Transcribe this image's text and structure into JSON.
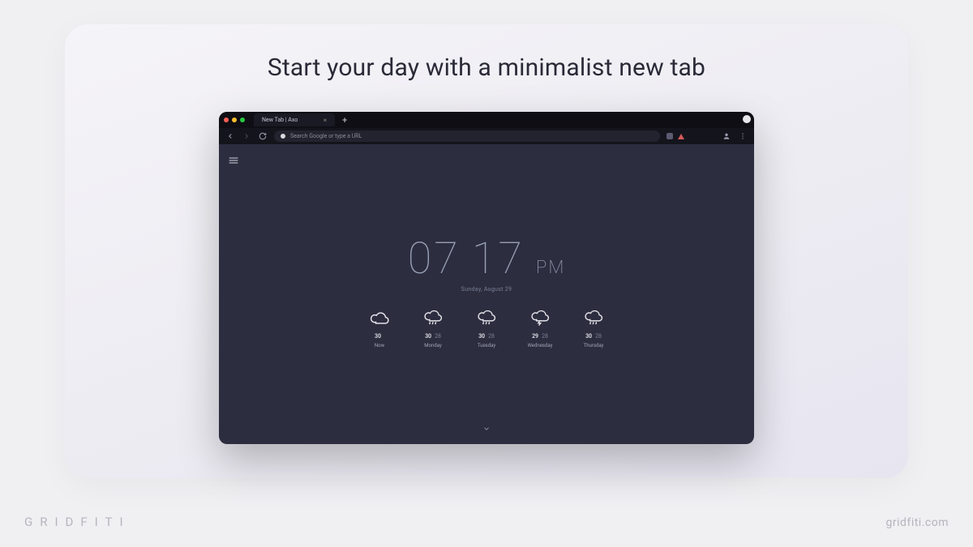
{
  "headline": "Start your day with a minimalist new tab",
  "browser": {
    "tab_title": "New Tab | Axo",
    "search_placeholder": "Search Google or type a URL"
  },
  "clock": {
    "hours": "07",
    "minutes": "17",
    "ampm": "PM",
    "date": "Sunday, August 29"
  },
  "forecast": [
    {
      "icon": "cloud",
      "hi": "30",
      "lo": "",
      "label": "Now"
    },
    {
      "icon": "rain",
      "hi": "30",
      "lo": "28",
      "label": "Monday"
    },
    {
      "icon": "rain",
      "hi": "30",
      "lo": "28",
      "label": "Tuesday"
    },
    {
      "icon": "storm",
      "hi": "29",
      "lo": "28",
      "label": "Wednesday"
    },
    {
      "icon": "rain",
      "hi": "30",
      "lo": "28",
      "label": "Thursday"
    }
  ],
  "watermark": {
    "brand": "GRIDFITI",
    "site": "gridfiti.com"
  }
}
